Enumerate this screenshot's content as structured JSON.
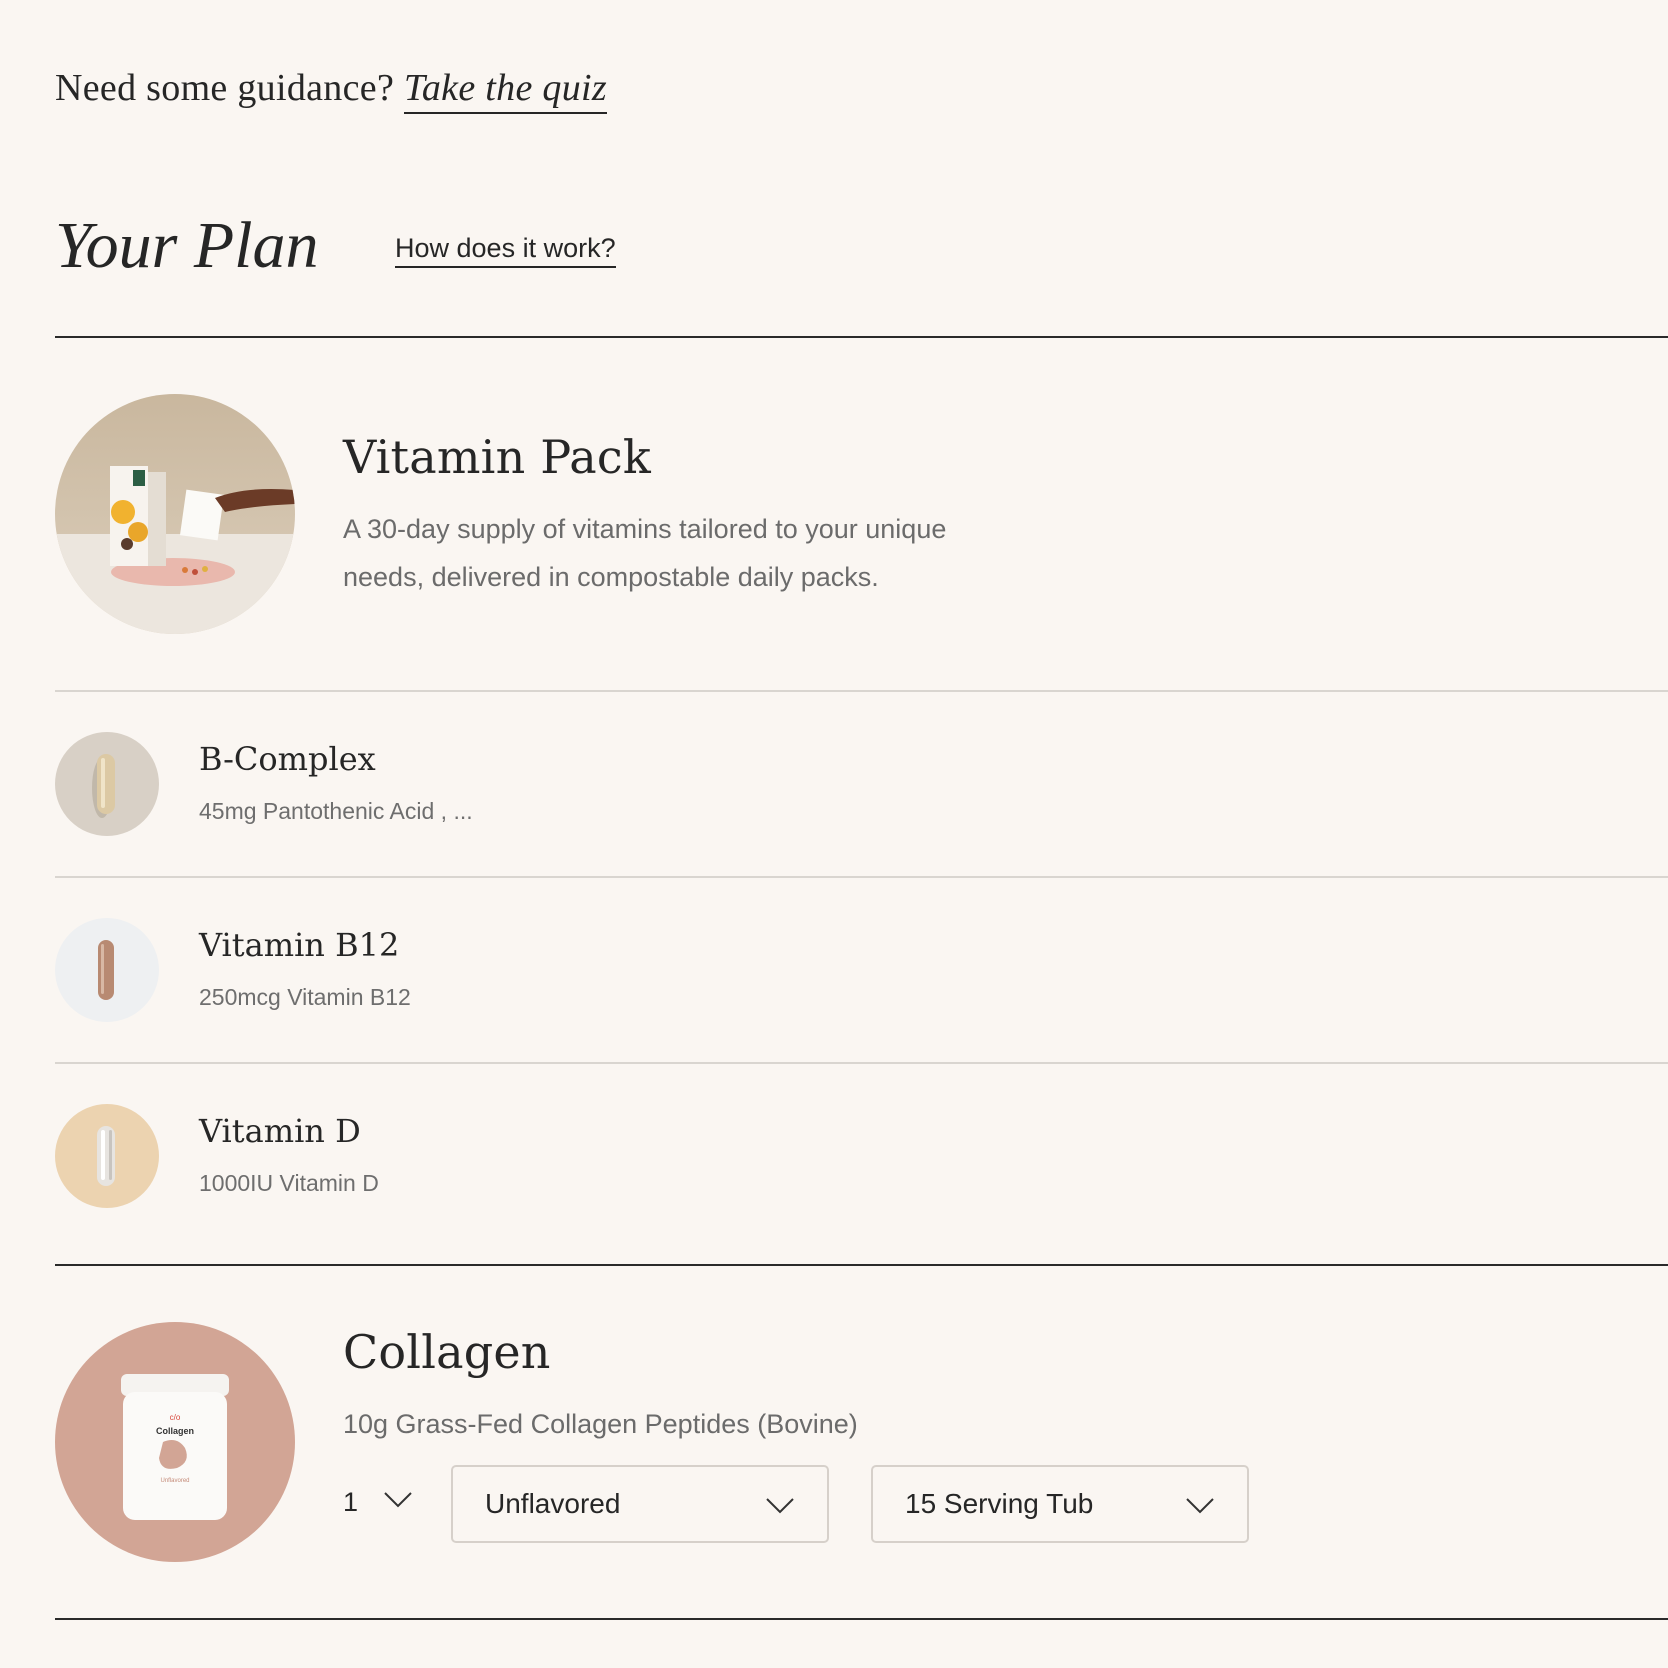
{
  "header": {
    "guidance_text": "Need some guidance?",
    "quiz_link": "Take the quiz",
    "plan_title": "Your Plan",
    "how_link": "How does it work?"
  },
  "vitamin_pack": {
    "name": "Vitamin Pack",
    "description": "A 30-day supply of vitamins tailored to your unique needs, delivered in compostable daily packs."
  },
  "items": [
    {
      "name": "B-Complex",
      "detail": "45mg Pantothenic Acid , ..."
    },
    {
      "name": "Vitamin B12",
      "detail": "250mcg Vitamin B12"
    },
    {
      "name": "Vitamin D",
      "detail": "1000IU Vitamin D"
    }
  ],
  "collagen": {
    "name": "Collagen",
    "description": "10g Grass-Fed Collagen Peptides (Bovine)",
    "quantity": "1",
    "flavor": "Unflavored",
    "size": "15 Serving Tub",
    "jar_label": "Collagen",
    "jar_sub": "Unflavored"
  },
  "colors": {
    "background": "#faf6f2",
    "text": "#262626",
    "muted": "#6b6b6b",
    "collagen_circle": "#d2a595",
    "vitd_circle": "#ecd3b0",
    "bcomplex_circle": "#d8d0c6",
    "b12_circle": "#eef0f2"
  },
  "icons": [
    "chevron-down-icon",
    "capsule-icon",
    "vitamin-box-icon",
    "collagen-jar-icon"
  ]
}
